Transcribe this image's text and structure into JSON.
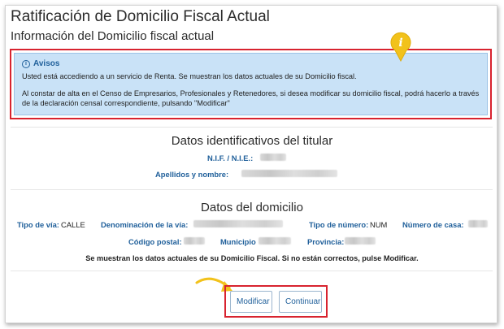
{
  "header": {
    "title": "Ratificación de Domicilio Fiscal Actual",
    "subtitle": "Información del Domicilio fiscal actual"
  },
  "avisos": {
    "title": "Avisos",
    "line1": "Usted está accediendo a un servicio de Renta. Se muestran los datos actuales de su Domicilio fiscal.",
    "line2": "Al constar de alta en el Censo de Empresarios, Profesionales y Retenedores, si desea modificar su domicilio fiscal, podrá hacerlo a través de la declaración censal correspondiente, pulsando \"Modificar\""
  },
  "titular": {
    "section_title": "Datos identificativos del titular",
    "nif_label": "N.I.F. / N.I.E.:",
    "nombre_label": "Apellidos y nombre:"
  },
  "domicilio": {
    "section_title": "Datos del domicilio",
    "tipo_via_label": "Tipo de vía:",
    "tipo_via_value": "CALLE",
    "denominacion_label": "Denominación de la vía:",
    "tipo_numero_label": "Tipo de número:",
    "tipo_numero_value": "NUM",
    "numero_casa_label": "Número de casa:",
    "codigo_postal_label": "Código postal:",
    "municipio_label": "Municipio",
    "provincia_label": "Provincia:"
  },
  "notice": "Se muestran los datos actuales de su Domicilio Fiscal. Si no están correctos, pulse Modificar.",
  "buttons": {
    "modificar": "Modificar",
    "continuar": "Continuar"
  },
  "icons": {
    "pin": "info-pin-icon",
    "arrow": "curved-arrow-icon"
  },
  "colors": {
    "accent": "#1f5f9a",
    "highlight": "#d8232f",
    "info_bg": "#c9e2f7",
    "pin": "#f2c21b"
  }
}
